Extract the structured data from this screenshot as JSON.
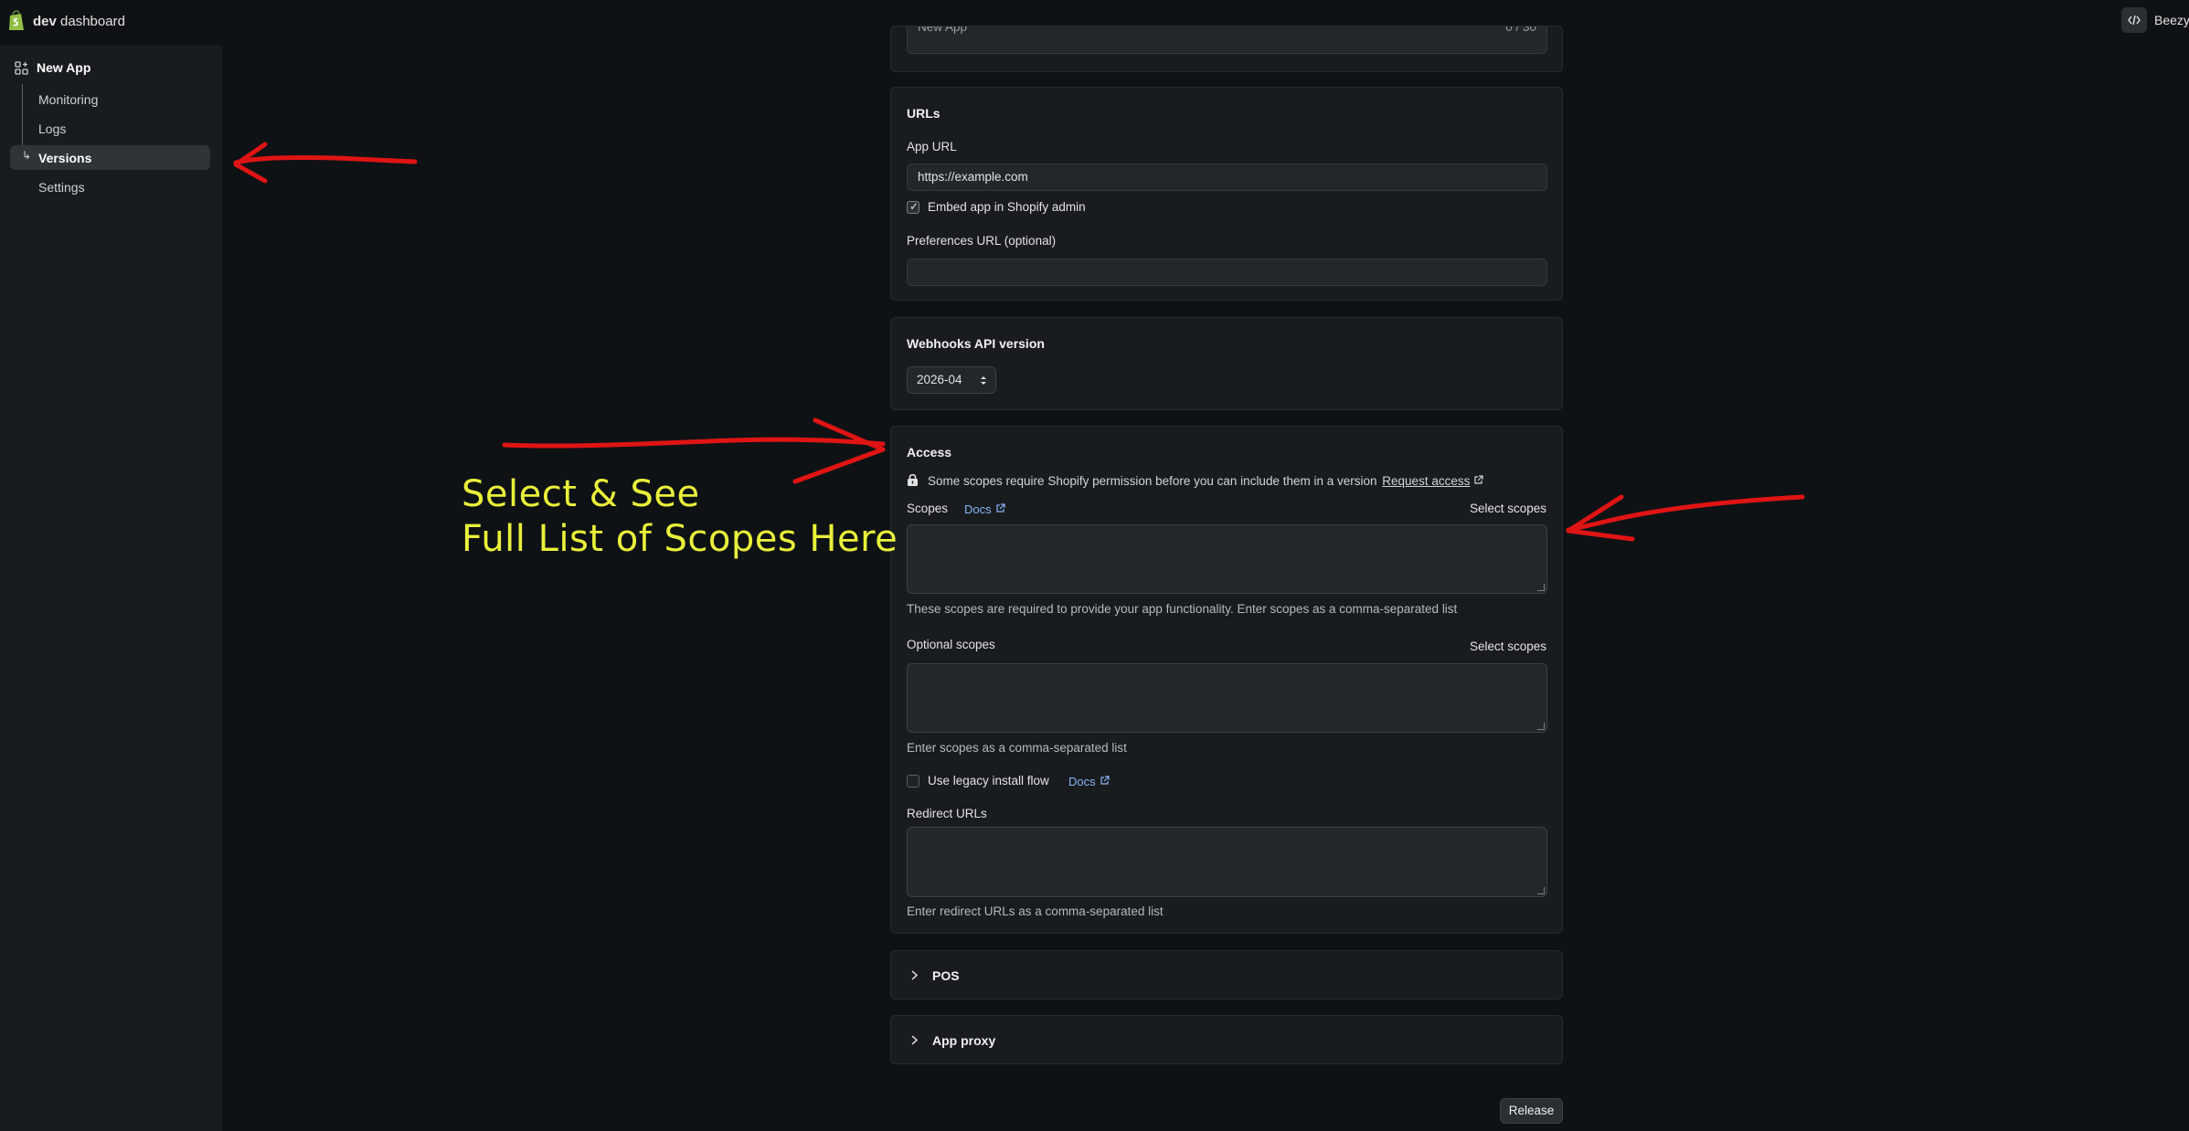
{
  "topbar": {
    "brand_bold": "dev",
    "brand_rest": " dashboard",
    "user_name": "Beezy"
  },
  "sidebar": {
    "app_name": "New App",
    "items": [
      {
        "label": "Monitoring"
      },
      {
        "label": "Logs"
      },
      {
        "label": "Versions",
        "active": true
      },
      {
        "label": "Settings"
      }
    ]
  },
  "top_card": {
    "value": "New App",
    "extra": "0 / 30"
  },
  "urls": {
    "title": "URLs",
    "app_url_label": "App URL",
    "app_url_value": "https://example.com",
    "embed_label": "Embed app in Shopify admin",
    "embed_checked": true,
    "preferences_label": "Preferences URL (optional)",
    "preferences_value": ""
  },
  "webhooks": {
    "title": "Webhooks API version",
    "version": "2026-04"
  },
  "access": {
    "title": "Access",
    "notice": "Some scopes require Shopify permission before you can include them in a version",
    "request_access": "Request access",
    "scopes_label": "Scopes",
    "docs_label": "Docs",
    "select_scopes": "Select scopes",
    "scopes_help": "These scopes are required to provide your app functionality. Enter scopes as a comma-separated list",
    "optional_label": "Optional scopes",
    "optional_help": "Enter scopes as a comma-separated list",
    "legacy_label": "Use legacy install flow",
    "legacy_docs": "Docs",
    "redirect_label": "Redirect URLs",
    "redirect_help": "Enter redirect URLs as a comma-separated list"
  },
  "pos": {
    "title": "POS"
  },
  "app_proxy": {
    "title": "App proxy"
  },
  "release_label": "Release",
  "annotation": {
    "line1": "Select & See",
    "line2": "Full List of Scopes Here"
  },
  "colors": {
    "annotation_red": "#e01414",
    "annotation_yellow": "#e9f03a",
    "link_blue": "#8ab4f8"
  }
}
